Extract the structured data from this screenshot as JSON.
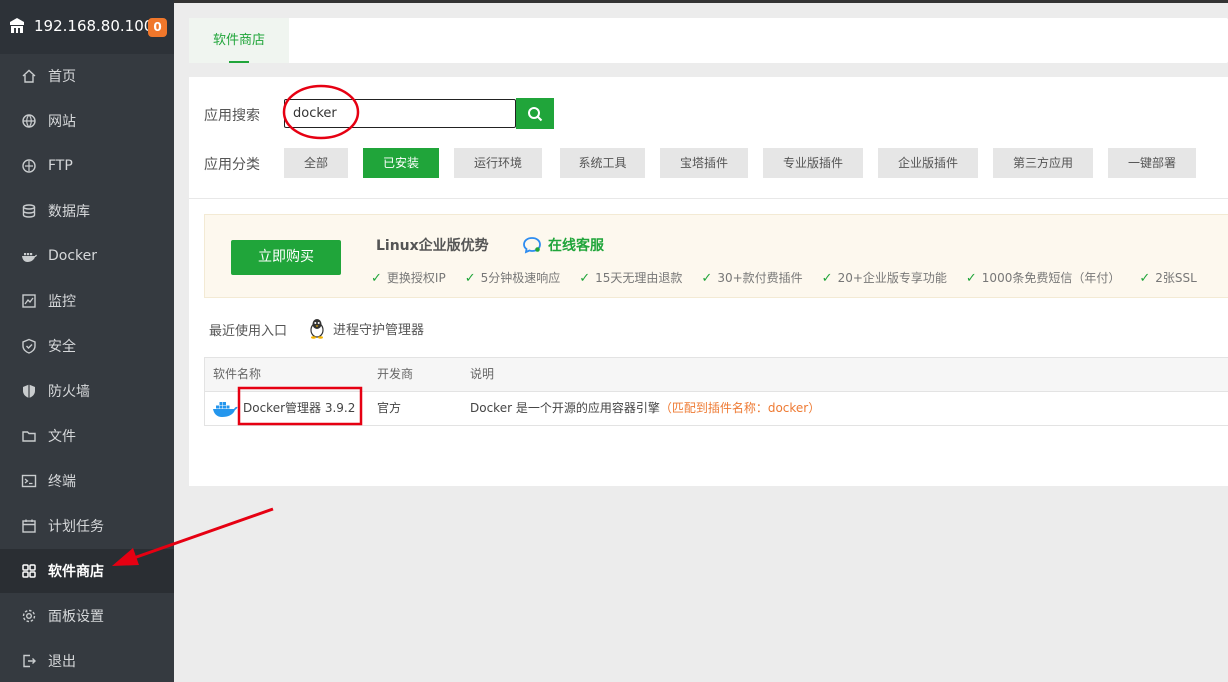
{
  "sidebar": {
    "host": "192.168.80.100",
    "badge": "0",
    "items": [
      {
        "label": "首页",
        "icon": "home-icon"
      },
      {
        "label": "网站",
        "icon": "globe-icon"
      },
      {
        "label": "FTP",
        "icon": "ftp-icon"
      },
      {
        "label": "数据库",
        "icon": "database-icon"
      },
      {
        "label": "Docker",
        "icon": "docker-icon"
      },
      {
        "label": "监控",
        "icon": "monitor-icon"
      },
      {
        "label": "安全",
        "icon": "shield-icon"
      },
      {
        "label": "防火墙",
        "icon": "firewall-icon"
      },
      {
        "label": "文件",
        "icon": "folder-icon"
      },
      {
        "label": "终端",
        "icon": "terminal-icon"
      },
      {
        "label": "计划任务",
        "icon": "calendar-icon"
      },
      {
        "label": "软件商店",
        "icon": "grid-icon"
      },
      {
        "label": "面板设置",
        "icon": "gear-icon"
      },
      {
        "label": "退出",
        "icon": "logout-icon"
      }
    ],
    "active_index": 11
  },
  "tabs": {
    "store": "软件商店"
  },
  "search": {
    "label": "应用搜索",
    "value": "docker"
  },
  "categories": {
    "label": "应用分类",
    "items": [
      "全部",
      "已安装",
      "运行环境",
      "系统工具",
      "宝塔插件",
      "专业版插件",
      "企业版插件",
      "第三方应用",
      "一键部署"
    ],
    "active_index": 1
  },
  "promo": {
    "buy": "立即购买",
    "title": "Linux企业版优势",
    "service": "在线客服",
    "features": [
      "更换授权IP",
      "5分钟极速响应",
      "15天无理由退款",
      "30+款付费插件",
      "20+企业版专享功能",
      "1000条免费短信（年付）",
      "2张SSL"
    ]
  },
  "recent": {
    "label": "最近使用入口",
    "item": "进程守护管理器"
  },
  "table": {
    "headers": [
      "软件名称",
      "开发商",
      "说明"
    ],
    "row": {
      "name": "Docker管理器 3.9.2",
      "vendor": "官方",
      "desc": "Docker 是一个开源的应用容器引擎",
      "match": "（匹配到插件名称：docker）"
    }
  },
  "colors": {
    "accent": "#20a53a",
    "annotation": "#e60012",
    "sidebar": "#353a40"
  }
}
